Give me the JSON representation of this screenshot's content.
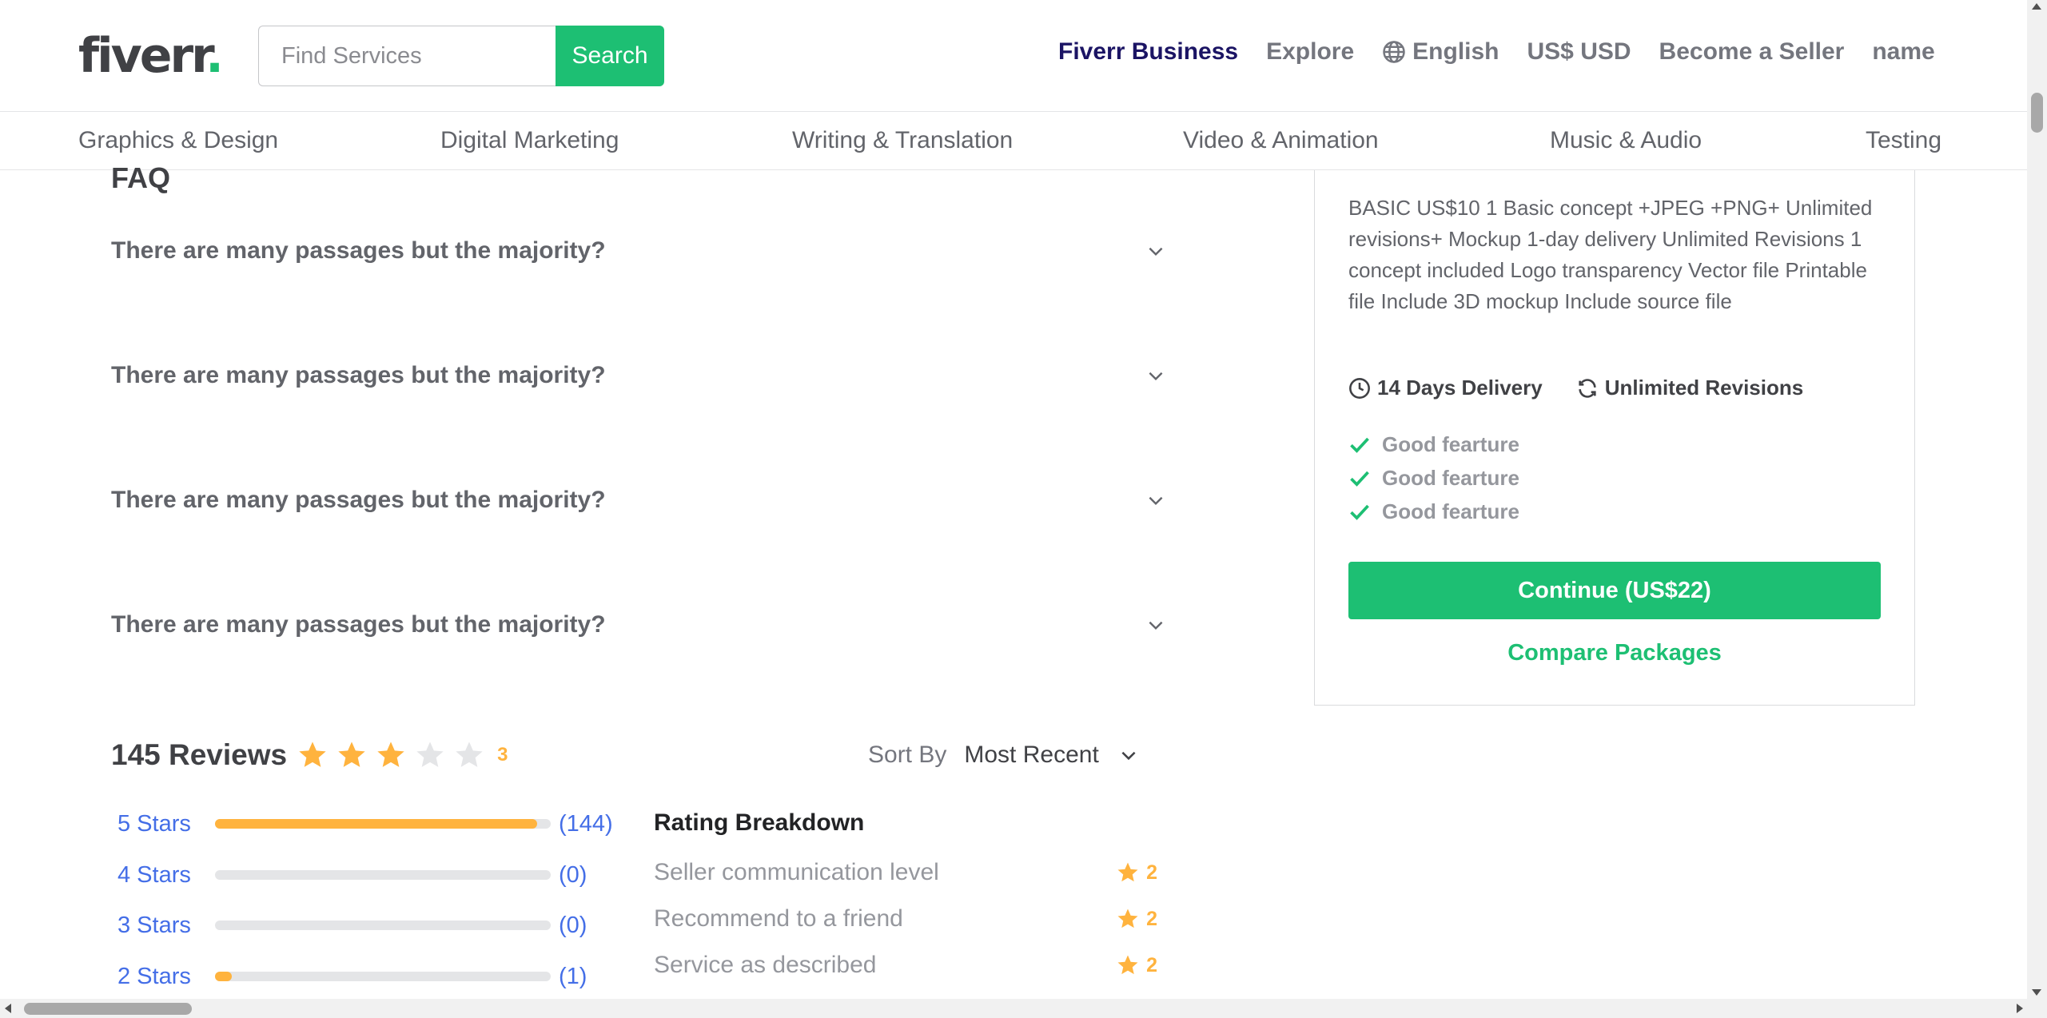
{
  "header": {
    "logo": "fiverr",
    "logo_dot": ".",
    "search": {
      "placeholder": "Find Services",
      "button_label": "Search"
    },
    "nav": {
      "business": "Fiverr Business",
      "explore": "Explore",
      "language": "English",
      "currency": "US$ USD",
      "become_seller": "Become a Seller",
      "user": "name"
    },
    "categories": [
      "Graphics & Design",
      "Digital Marketing",
      "Writing & Translation",
      "Video & Animation",
      "Music & Audio",
      "Testing"
    ]
  },
  "faq": {
    "title": "FAQ",
    "items": [
      "There are many passages but the majority?",
      "There are many passages but the majority?",
      "There are many passages but the majority?",
      "There are many passages but the majority?"
    ]
  },
  "reviews": {
    "count_label": "145 Reviews",
    "rating": "3",
    "rating_value": 3,
    "rating_max": 5,
    "sort_label": "Sort By",
    "sort_value": "Most Recent",
    "stars": [
      {
        "label": "5 Stars",
        "count": "(144)",
        "fraction": 0.96
      },
      {
        "label": "4 Stars",
        "count": "(0)",
        "fraction": 0
      },
      {
        "label": "3 Stars",
        "count": "(0)",
        "fraction": 0
      },
      {
        "label": "2 Stars",
        "count": "(1)",
        "fraction": 0.05
      }
    ],
    "breakdown_title": "Rating Breakdown",
    "breakdown": [
      {
        "label": "Seller communication level",
        "value": "2"
      },
      {
        "label": "Recommend to a friend",
        "value": "2"
      },
      {
        "label": "Service as described",
        "value": "2"
      }
    ]
  },
  "package": {
    "description": "BASIC US$10 1 Basic concept +JPEG +PNG+ Unlimited revisions+ Mockup 1-day delivery Unlimited Revisions 1 concept included Logo transparency Vector file Printable file Include 3D mockup Include source file",
    "delivery": "14 Days Delivery",
    "revisions": "Unlimited Revisions",
    "features": [
      "Good fearture",
      "Good fearture",
      "Good fearture"
    ],
    "continue_label": "Continue (US$22)",
    "compare_label": "Compare Packages"
  },
  "colors": {
    "brand_green": "#1dbf73",
    "star_yellow": "#ffb33e",
    "link_blue": "#446ee7",
    "business_navy": "#1b1464"
  }
}
